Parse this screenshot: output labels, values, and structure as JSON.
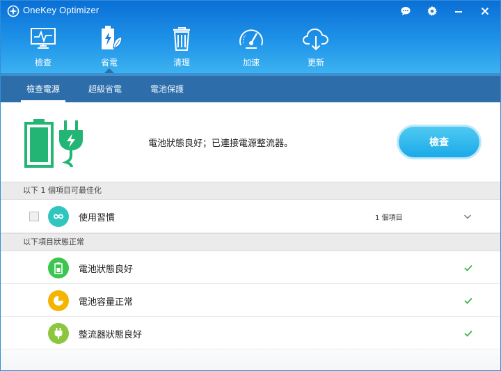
{
  "window": {
    "title": "OneKey Optimizer"
  },
  "title_bar": {
    "controls": [
      "feedback-icon",
      "settings-icon",
      "minimize-icon",
      "close-icon"
    ]
  },
  "nav": {
    "items": [
      {
        "label": "檢查",
        "icon": "monitor-icon",
        "active": false
      },
      {
        "label": "省電",
        "icon": "battery-leaf-icon",
        "active": true
      },
      {
        "label": "清理",
        "icon": "trash-icon",
        "active": false
      },
      {
        "label": "加速",
        "icon": "speedometer-icon",
        "active": false
      },
      {
        "label": "更新",
        "icon": "cloud-download-icon",
        "active": false
      }
    ]
  },
  "subtabs": {
    "items": [
      {
        "label": "檢查電源",
        "active": true
      },
      {
        "label": "超級省電",
        "active": false
      },
      {
        "label": "電池保護",
        "active": false
      }
    ]
  },
  "status": {
    "message": "電池狀態良好；已連接電源整流器。",
    "check_button": "檢查"
  },
  "optimizable": {
    "header": "以下 1 個項目可最佳化",
    "items": [
      {
        "label": "使用習慣",
        "count": "1 個項目",
        "icon": "infinity-icon",
        "color": "#2fc6c0",
        "checked": false
      }
    ]
  },
  "normal": {
    "header": "以下項目狀態正常",
    "items": [
      {
        "label": "電池狀態良好",
        "icon": "battery-icon",
        "color": "#3cc54f"
      },
      {
        "label": "電池容量正常",
        "icon": "pie-clock-icon",
        "color": "#f5b400"
      },
      {
        "label": "整流器狀態良好",
        "icon": "plug-icon",
        "color": "#8cc63f"
      }
    ]
  },
  "colors": {
    "header_top": "#0a6fd6",
    "header_bottom": "#3cb2f1",
    "subtab_bar": "#2d6eaa",
    "accent_green": "#22b573",
    "check_button": "#1aa9e8",
    "tick_green": "#3cb54a"
  }
}
